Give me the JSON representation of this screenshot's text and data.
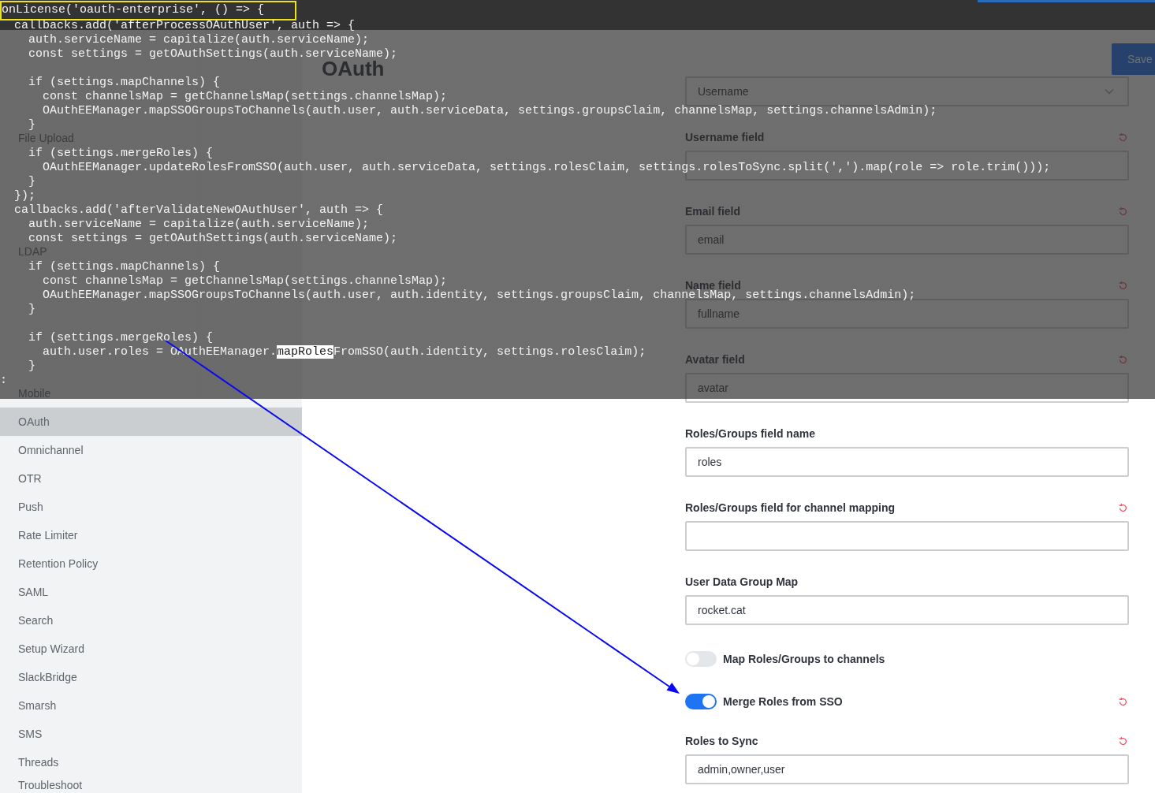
{
  "code_panel": {
    "lines": [
      {
        "kind": "framed",
        "text": "onLicense('oauth-enterprise', () => {"
      },
      {
        "kind": "plain",
        "text": "  callbacks.add('afterProcessOAuthUser', auth => {"
      },
      {
        "kind": "plain",
        "text": "    auth.serviceName = capitalize(auth.serviceName);"
      },
      {
        "kind": "plain",
        "text": "    const settings = getOAuthSettings(auth.serviceName);"
      },
      {
        "kind": "blank"
      },
      {
        "kind": "plain",
        "text": "    if (settings.mapChannels) {"
      },
      {
        "kind": "plain",
        "text": "      const channelsMap = getChannelsMap(settings.channelsMap);"
      },
      {
        "kind": "plain",
        "text": "      OAuthEEManager.mapSSOGroupsToChannels(auth.user, auth.serviceData, settings.groupsClaim, channelsMap, settings.channelsAdmin);"
      },
      {
        "kind": "plain",
        "text": "    }"
      },
      {
        "kind": "blank"
      },
      {
        "kind": "plain",
        "text": "    if (settings.mergeRoles) {"
      },
      {
        "kind": "plain",
        "text": "      OAuthEEManager.updateRolesFromSSO(auth.user, auth.serviceData, settings.rolesClaim, settings.rolesToSync.split(',').map(role => role.trim()));"
      },
      {
        "kind": "plain",
        "text": "    }"
      },
      {
        "kind": "plain",
        "text": "  });"
      },
      {
        "kind": "plain",
        "text": "  callbacks.add('afterValidateNewOAuthUser', auth => {"
      },
      {
        "kind": "plain",
        "text": "    auth.serviceName = capitalize(auth.serviceName);"
      },
      {
        "kind": "plain",
        "text": "    const settings = getOAuthSettings(auth.serviceName);"
      },
      {
        "kind": "blank"
      },
      {
        "kind": "plain",
        "text": "    if (settings.mapChannels) {"
      },
      {
        "kind": "plain",
        "text": "      const channelsMap = getChannelsMap(settings.channelsMap);"
      },
      {
        "kind": "plain",
        "text": "      OAuthEEManager.mapSSOGroupsToChannels(auth.user, auth.identity, settings.groupsClaim, channelsMap, settings.channelsAdmin);"
      },
      {
        "kind": "plain",
        "text": "    }"
      },
      {
        "kind": "blank"
      },
      {
        "kind": "plain",
        "text": "    if (settings.mergeRoles) {"
      },
      {
        "kind": "selection",
        "before": "      auth.user.roles = OAuthEEManager.",
        "selection": "mapRoles",
        "after": "FromSSO(auth.identity, settings.rolesClaim);"
      },
      {
        "kind": "plain",
        "text": "    }"
      },
      {
        "kind": "plain",
        "text": ":"
      }
    ]
  },
  "sidebar": {
    "items": [
      {
        "label": "File Upload",
        "selected": false
      },
      {
        "label": "LDAP",
        "selected": false
      },
      {
        "label": "Mobile",
        "selected": false
      },
      {
        "label": "OAuth",
        "selected": true
      },
      {
        "label": "Omnichannel",
        "selected": false
      },
      {
        "label": "OTR",
        "selected": false
      },
      {
        "label": "Push",
        "selected": false
      },
      {
        "label": "Rate Limiter",
        "selected": false
      },
      {
        "label": "Retention Policy",
        "selected": false
      },
      {
        "label": "SAML",
        "selected": false
      },
      {
        "label": "Search",
        "selected": false
      },
      {
        "label": "Setup Wizard",
        "selected": false
      },
      {
        "label": "SlackBridge",
        "selected": false
      },
      {
        "label": "Smarsh",
        "selected": false
      },
      {
        "label": "SMS",
        "selected": false
      },
      {
        "label": "Threads",
        "selected": false
      },
      {
        "label": "Troubleshoot",
        "selected": false
      }
    ]
  },
  "page_header": {
    "title": "OAuth",
    "save_button": "Save"
  },
  "form": {
    "fields": [
      {
        "kind": "select",
        "value": "Username"
      },
      {
        "kind": "text",
        "label": "Username field",
        "resettable": true
      },
      {
        "kind": "text",
        "label": "Email field",
        "value": "email",
        "resettable": true
      },
      {
        "kind": "text",
        "label": "Name field",
        "value": "fullname",
        "resettable": true
      },
      {
        "kind": "text",
        "label": "Avatar field",
        "value": "avatar",
        "resettable": true
      },
      {
        "kind": "text",
        "label": "Roles/Groups field name",
        "value": "roles",
        "resettable": false
      },
      {
        "kind": "text",
        "label": "Roles/Groups field for channel mapping",
        "resettable": true
      },
      {
        "kind": "text",
        "label": "User Data Group Map",
        "value": "rocket.cat",
        "resettable": false
      },
      {
        "kind": "toggle",
        "label": "Map Roles/Groups to channels",
        "on": false,
        "resettable": false
      },
      {
        "kind": "toggle",
        "label": "Merge Roles from SSO",
        "on": true,
        "resettable": true
      },
      {
        "kind": "text",
        "label": "Roles to Sync",
        "value": "admin,owner,user",
        "resettable": true
      }
    ]
  },
  "annotations": [
    {
      "kind": "arrow"
    }
  ]
}
